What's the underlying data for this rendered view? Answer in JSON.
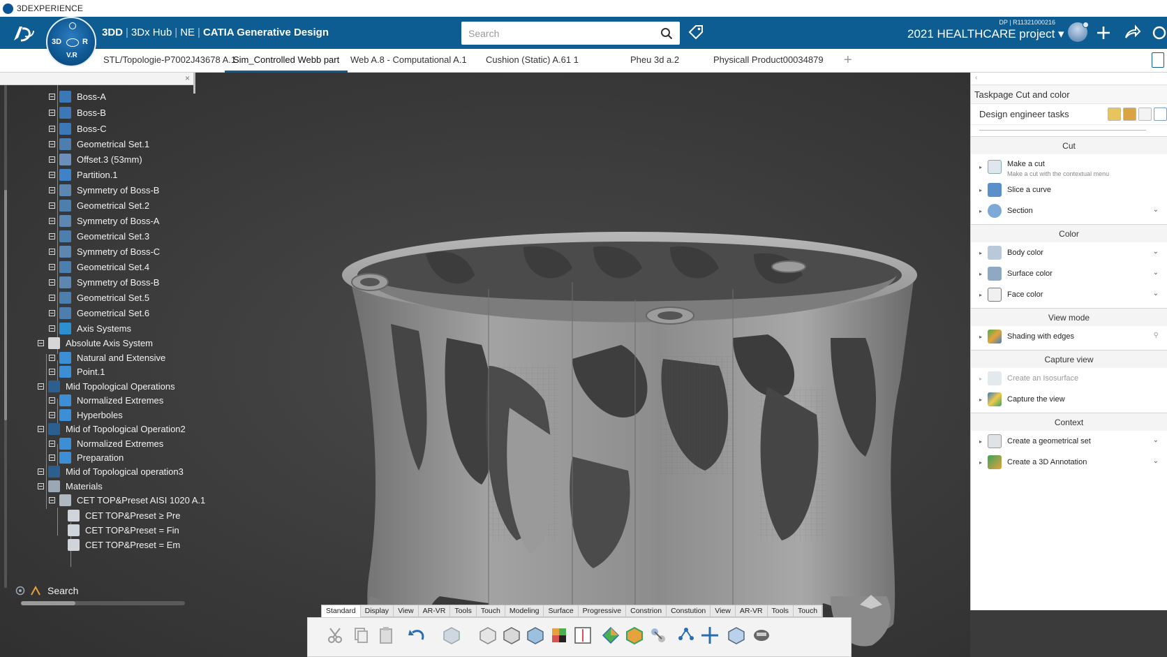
{
  "app": {
    "window_title": "3DEXPERIENCE",
    "brand_3dd": "3DD",
    "hub": "3Dx Hub",
    "region": "NE",
    "product": "CATIA Generative Design",
    "compass": {
      "left": "3D",
      "right": "R",
      "bottom": "V.R"
    }
  },
  "header": {
    "search_placeholder": "Search",
    "project_id": "DP | R11321000216",
    "project_name": "2021 HEALTHCARE project ▾"
  },
  "tabs": [
    {
      "label": "STL/Topologie-P7002J43678 A.1",
      "active": false
    },
    {
      "label": "Sim_Controlled Webb part",
      "active": true
    },
    {
      "label": "Web A.8 - Computational A.1",
      "active": false
    },
    {
      "label": "Cushion (Static) A.61 1",
      "active": false
    },
    {
      "label": "Pheu 3d a.2",
      "active": false
    },
    {
      "label": "Physicall Product00034879",
      "active": false
    }
  ],
  "tree": {
    "nodes": [
      {
        "label": "Boss-A",
        "icon": "boss-icon"
      },
      {
        "label": "Boss-B",
        "icon": "boss-icon"
      },
      {
        "label": "Boss-C",
        "icon": "boss-icon"
      },
      {
        "label": "Geometrical Set.1",
        "icon": "geometrical-set-icon"
      },
      {
        "label": "Offset.3 (53mm)",
        "icon": "offset-icon"
      },
      {
        "label": "Partition.1",
        "icon": "partition-icon"
      },
      {
        "label": "Symmetry of Boss-B",
        "icon": "symmetry-icon"
      },
      {
        "label": "Geometrical Set.2",
        "icon": "geometrical-set-icon"
      },
      {
        "label": "Symmetry of Boss-A",
        "icon": "symmetry-icon"
      },
      {
        "label": "Geometrical Set.3",
        "icon": "geometrical-set-icon"
      },
      {
        "label": "Symmetry of Boss-C",
        "icon": "symmetry-icon"
      },
      {
        "label": "Geometrical Set.4",
        "icon": "geometrical-set-icon"
      },
      {
        "label": "Symmetry of Boss-B",
        "icon": "symmetry-icon"
      },
      {
        "label": "Geometrical Set.5",
        "icon": "geometrical-set-icon"
      },
      {
        "label": "Geometrical Set.6",
        "icon": "geometrical-set-icon"
      },
      {
        "label": "Axis Systems",
        "icon": "axis-systems-icon"
      },
      {
        "label": "Absolute Axis System",
        "icon": "axis-system-icon"
      },
      {
        "label": "Natural and Extensive",
        "icon": "operation-icon"
      },
      {
        "label": "Point.1",
        "icon": "point-icon"
      },
      {
        "label": "Mid Topological Operations",
        "icon": "topological-icon"
      },
      {
        "label": "Normalized Extremes",
        "icon": "operation-icon"
      },
      {
        "label": "Hyperboles",
        "icon": "operation-icon"
      },
      {
        "label": "Mid of Topological Operation2",
        "icon": "topological-icon"
      },
      {
        "label": "Normalized Extremes",
        "icon": "operation-icon"
      },
      {
        "label": "Preparation",
        "icon": "operation-icon"
      },
      {
        "label": "Mid of Topological operation3",
        "icon": "topological-icon"
      },
      {
        "label": "Materials",
        "icon": "materials-icon"
      },
      {
        "label": "CET TOP&Preset AISI 1020 A.1",
        "icon": "material-icon"
      },
      {
        "label": "CET TOP&Preset ≥ Pre",
        "icon": "material-preset-icon"
      },
      {
        "label": "CET TOP&Preset = Fin",
        "icon": "material-preset-icon"
      },
      {
        "label": "CET TOP&Preset = Em",
        "icon": "material-preset-icon"
      }
    ],
    "search_label": "Search"
  },
  "panel": {
    "title": "Taskpage Cut and color",
    "tasks_label": "Design engineer tasks",
    "sections": {
      "cut": "Cut",
      "color": "Color",
      "view_mode": "View mode",
      "capture_view": "Capture view",
      "context": "Context"
    },
    "items": {
      "make_cut": "Make a cut",
      "make_cut_sub": "Make a cut with the contextual menu",
      "slice_curve": "Slice a curve",
      "section": "Section",
      "body_color": "Body color",
      "surface_color": "Surface color",
      "face_color": "Face color",
      "shading_edges": "Shading with edges",
      "create_isosurface": "Create an Isosurface",
      "capture_view": "Capture the view",
      "create_geo_set": "Create a geometrical set",
      "create_3d_annotation": "Create a 3D Annotation"
    }
  },
  "toolbar": {
    "tabs": [
      "Standard",
      "Display",
      "View",
      "AR-VR",
      "Tools",
      "Touch",
      "Modeling",
      "Surface",
      "Progressive",
      "Constrion",
      "Constution",
      "View",
      "AR-VR",
      "Tools",
      "Touch"
    ],
    "active_tab": "Standard"
  },
  "colors": {
    "header_blue": "#0d5d93",
    "viewport_bg": "#3b3b3b",
    "model_gray": "#9a9a9a"
  }
}
